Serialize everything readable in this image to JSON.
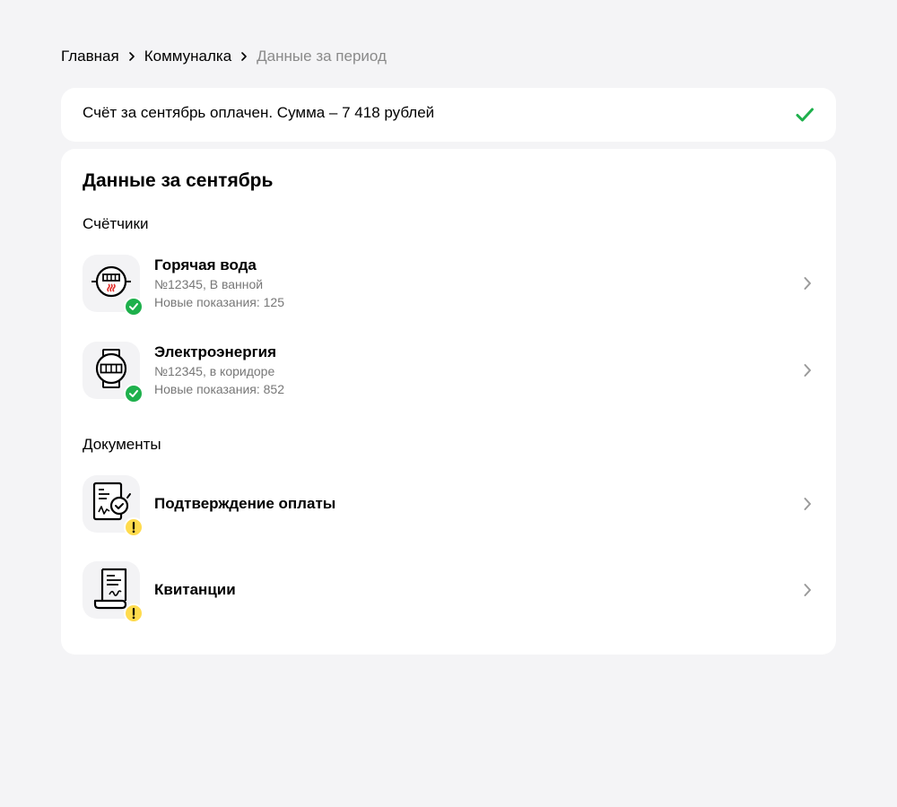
{
  "breadcrumb": {
    "items": [
      "Главная",
      "Коммуналка",
      "Данные за период"
    ]
  },
  "status": {
    "text": "Счёт за сентябрь оплачен. Сумма – 7 418 рублей",
    "icon": "check-icon",
    "color": "#1eb04c"
  },
  "main": {
    "title": "Данные за сентябрь",
    "meters_section": {
      "title": "Счётчики",
      "items": [
        {
          "title": "Горячая вода",
          "location": "№12345, В ванной",
          "reading": "Новые показания: 125",
          "icon": "hot-water-meter-icon",
          "status": "ok"
        },
        {
          "title": "Электроэнергия",
          "location": "№12345, в коридоре",
          "reading": "Новые показания: 852",
          "icon": "electricity-meter-icon",
          "status": "ok"
        }
      ]
    },
    "documents_section": {
      "title": "Документы",
      "items": [
        {
          "title": "Подтверждение оплаты",
          "icon": "payment-confirmation-icon",
          "status": "warning"
        },
        {
          "title": "Квитанции",
          "icon": "receipt-icon",
          "status": "warning"
        }
      ]
    }
  },
  "colors": {
    "background": "#f4f4f6",
    "success": "#1eb04c",
    "warning": "#ffdb4d",
    "muted": "#8a8a8a"
  }
}
